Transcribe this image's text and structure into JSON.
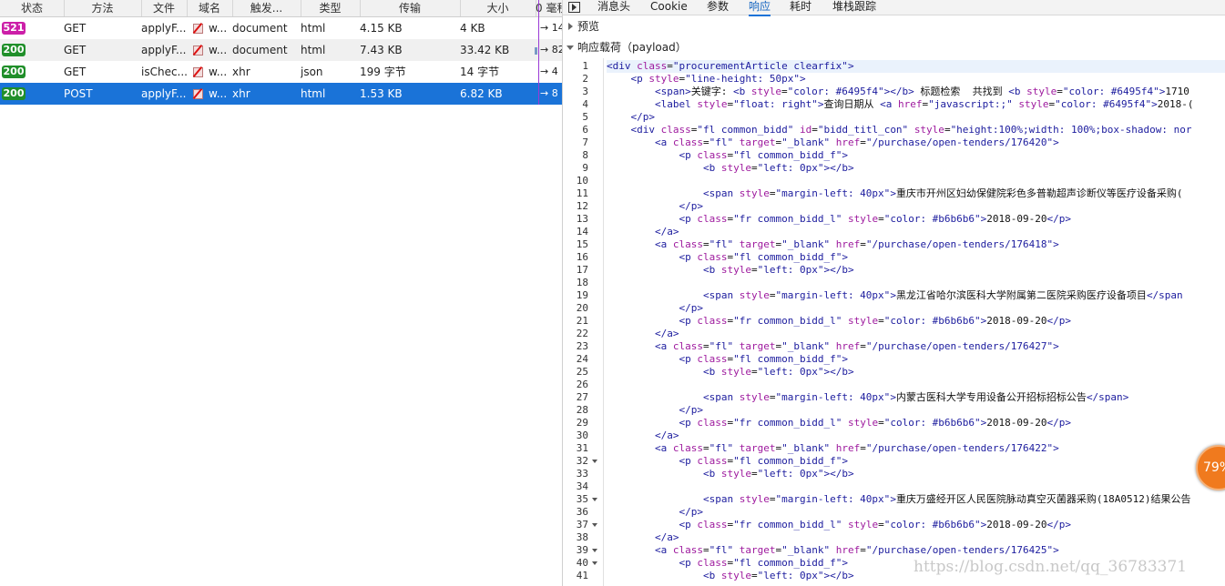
{
  "network": {
    "columns": [
      "状态",
      "方法",
      "文件",
      "域名",
      "触发...",
      "类型",
      "传输",
      "大小",
      "0 毫秒"
    ],
    "rows": [
      {
        "status": "521",
        "method": "GET",
        "file": "applyF...",
        "domain": "w...",
        "cause": "document",
        "type": "html",
        "transferred": "4.15 KB",
        "size": "4 KB",
        "timing": "→ 14"
      },
      {
        "status": "200",
        "method": "GET",
        "file": "applyF...",
        "domain": "w...",
        "cause": "document",
        "type": "html",
        "transferred": "7.43 KB",
        "size": "33.42 KB",
        "timing": "→ 82"
      },
      {
        "status": "200",
        "method": "GET",
        "file": "isChec...",
        "domain": "w...",
        "cause": "xhr",
        "type": "json",
        "transferred": "199 字节",
        "size": "14 字节",
        "timing": "→ 4"
      },
      {
        "status": "200",
        "method": "POST",
        "file": "applyF...",
        "domain": "w...",
        "cause": "xhr",
        "type": "html",
        "transferred": "1.53 KB",
        "size": "6.82 KB",
        "timing": "→ 8"
      }
    ],
    "selected_row": 3
  },
  "detail": {
    "tabs": [
      "消息头",
      "Cookie",
      "参数",
      "响应",
      "耗时",
      "堆栈跟踪"
    ],
    "active_tab": "响应",
    "preview_label": "预览",
    "payload_label": "响应载荷（payload）"
  },
  "code_lines": [
    "<div class=\"procurementArticle clearfix\">",
    "    <p style=\"line-height: 50px\">",
    "        <span>关键字: <b style=\"color: #6495f4\"></b> 标题检索  共找到 <b style=\"color: #6495f4\">1710",
    "        <label style=\"float: right\">查询日期从 <a href=\"javascript:;\" style=\"color: #6495f4\">2018-(",
    "    </p>",
    "    <div class=\"fl common_bidd\" id=\"bidd_titl_con\" style=\"height:100%;width: 100%;box-shadow: nor",
    "        <a class=\"fl\" target=\"_blank\" href=\"/purchase/open-tenders/176420\">",
    "            <p class=\"fl common_bidd_f\">",
    "                <b style=\"left: 0px\"></b>",
    "",
    "                <span style=\"margin-left: 40px\">重庆市开州区妇幼保健院彩色多普勒超声诊断仪等医疗设备采购(",
    "            </p>",
    "            <p class=\"fr common_bidd_l\" style=\"color: #b6b6b6\">2018-09-20</p>",
    "        </a>",
    "        <a class=\"fl\" target=\"_blank\" href=\"/purchase/open-tenders/176418\">",
    "            <p class=\"fl common_bidd_f\">",
    "                <b style=\"left: 0px\"></b>",
    "",
    "                <span style=\"margin-left: 40px\">黑龙江省哈尔滨医科大学附属第二医院采购医疗设备项目</span",
    "            </p>",
    "            <p class=\"fr common_bidd_l\" style=\"color: #b6b6b6\">2018-09-20</p>",
    "        </a>",
    "        <a class=\"fl\" target=\"_blank\" href=\"/purchase/open-tenders/176427\">",
    "            <p class=\"fl common_bidd_f\">",
    "                <b style=\"left: 0px\"></b>",
    "",
    "                <span style=\"margin-left: 40px\">内蒙古医科大学专用设备公开招标招标公告</span>",
    "            </p>",
    "            <p class=\"fr common_bidd_l\" style=\"color: #b6b6b6\">2018-09-20</p>",
    "        </a>",
    "        <a class=\"fl\" target=\"_blank\" href=\"/purchase/open-tenders/176422\">",
    "            <p class=\"fl common_bidd_f\">",
    "                <b style=\"left: 0px\"></b>",
    "",
    "                <span style=\"margin-left: 40px\">重庆万盛经开区人民医院脉动真空灭菌器采购(18A0512)结果公告",
    "            </p>",
    "            <p class=\"fr common_bidd_l\" style=\"color: #b6b6b6\">2018-09-20</p>",
    "        </a>",
    "        <a class=\"fl\" target=\"_blank\" href=\"/purchase/open-tenders/176425\">",
    "            <p class=\"fl common_bidd_f\">",
    "                <b style=\"left: 0px\"></b>"
  ],
  "fold_lines": [
    32,
    35,
    37,
    39,
    40
  ],
  "overlay": {
    "speed_gauge": "79%",
    "watermark": "https://blog.csdn.net/qq_36783371"
  },
  "colors": {
    "selected_row": "#1a73d8",
    "badge_521": "#cc1fa8",
    "badge_200": "#208f2a",
    "tag": "#1c1c9e",
    "attribute": "#9e1a9e"
  }
}
